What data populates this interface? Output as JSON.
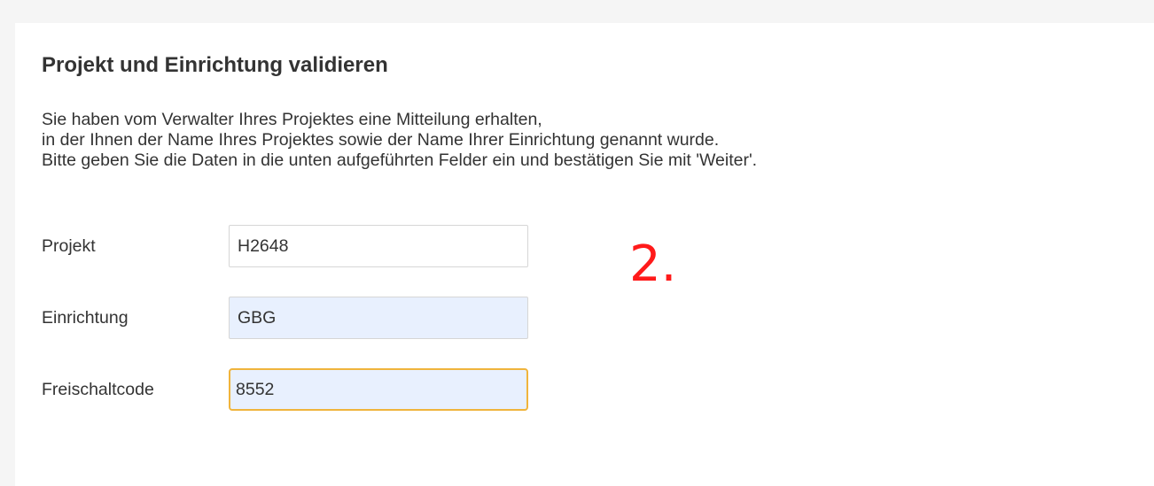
{
  "form": {
    "title": "Projekt und Einrichtung validieren",
    "intro_lines": [
      "Sie haben vom Verwalter Ihres Projektes eine Mitteilung erhalten,",
      "in der Ihnen der Name Ihres Projektes sowie der Name Ihrer Einrichtung genannt wurde.",
      "Bitte geben Sie die Daten in die unten aufgeführten Felder ein und bestätigen Sie mit 'Weiter'."
    ],
    "fields": {
      "project": {
        "label": "Projekt",
        "value": "H2648"
      },
      "institution": {
        "label": "Einrichtung",
        "value": "GBG"
      },
      "unlock_code": {
        "label": "Freischaltcode",
        "value": "8552"
      }
    }
  },
  "annotation": {
    "text": "2.",
    "color": "#ff1a1a"
  },
  "colors": {
    "autofill_background": "#e8f0fe",
    "focus_border": "#f0b43c"
  }
}
